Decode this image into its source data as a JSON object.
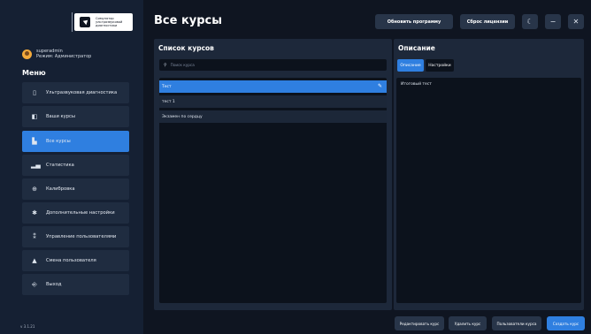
{
  "sidebar": {
    "logo_text": "Симулятор\nультразвуковой\nдиагностики",
    "user": {
      "name": "superadmin",
      "mode": "Режим: Администратор"
    },
    "menu_title": "Меню",
    "items": [
      {
        "label": "Ультразвуковая диагностика",
        "icon": "phone-icon"
      },
      {
        "label": "Ваши курсы",
        "icon": "book-icon"
      },
      {
        "label": "Все курсы",
        "icon": "library-icon",
        "active": true
      },
      {
        "label": "Статистика",
        "icon": "chart-icon"
      },
      {
        "label": "Калибровка",
        "icon": "crosshair-icon"
      },
      {
        "label": "Дополнительные настройки",
        "icon": "gear-icon"
      },
      {
        "label": "Управление пользователями",
        "icon": "users-icon"
      },
      {
        "label": "Смена пользователя",
        "icon": "user-icon"
      },
      {
        "label": "Выход",
        "icon": "logout-icon"
      }
    ],
    "version": "v 3.1.21"
  },
  "header": {
    "title": "Все курсы",
    "update_label": "Обновить программу",
    "reset_label": "Сброс лицензии"
  },
  "courses": {
    "title": "Список курсов",
    "search_placeholder": "Поиск курса",
    "items": [
      "Тест",
      "тест 1",
      "Экзамен по сердцу"
    ]
  },
  "description": {
    "title": "Описание",
    "tabs": [
      "Описание",
      "Настройки"
    ],
    "text": "Итоговый тест"
  },
  "actions": {
    "edit": "Редактировать курс",
    "delete": "Удалить курс",
    "users": "Пользователи курса",
    "create": "Создать курс"
  },
  "colors": {
    "accent": "#2f7fe0",
    "background": "#0f1521",
    "panel": "#1d283a"
  }
}
